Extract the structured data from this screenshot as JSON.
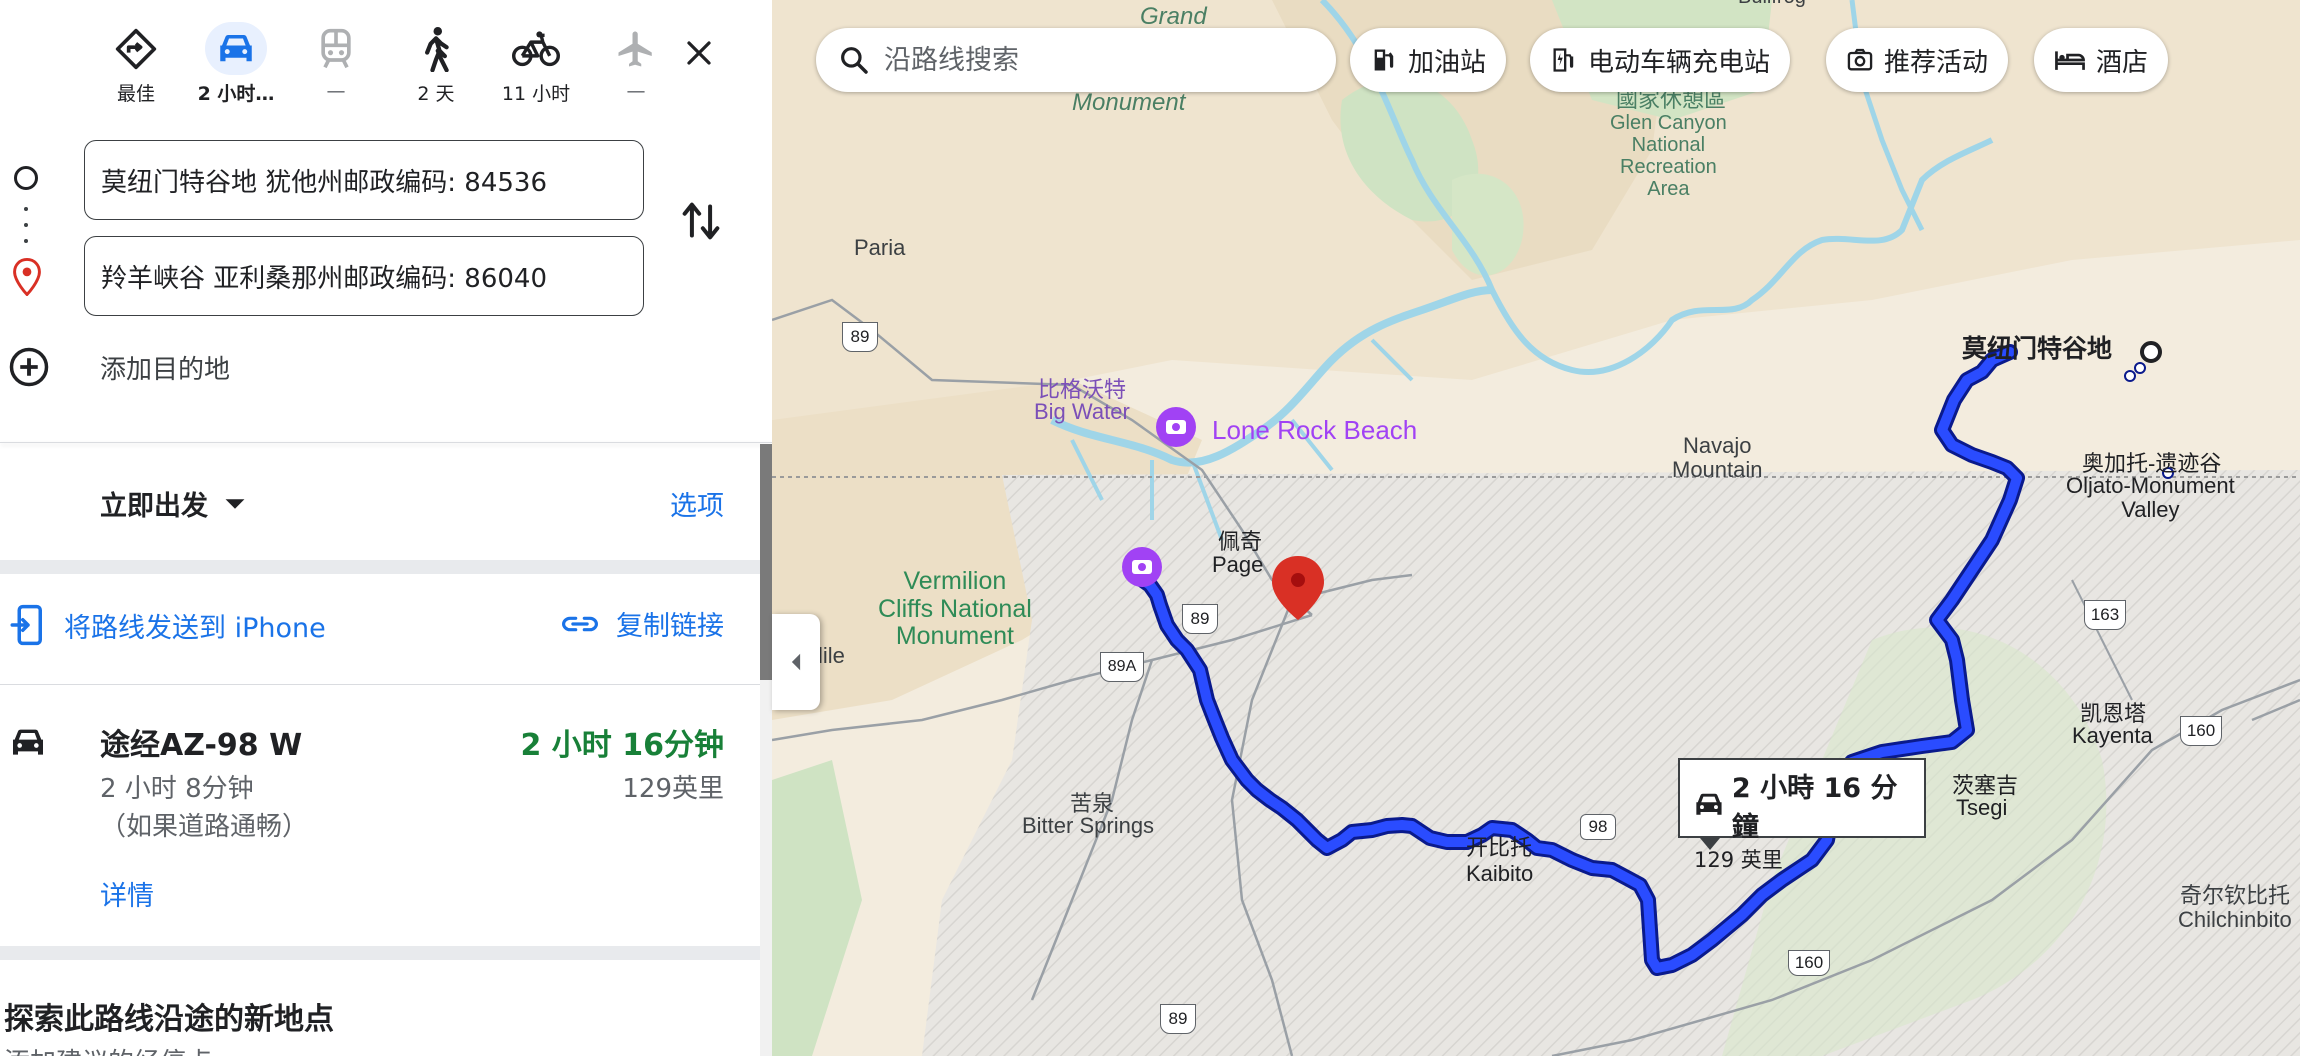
{
  "modes": [
    {
      "name": "best",
      "label": "最佳"
    },
    {
      "name": "drive",
      "label": "2 小时…"
    },
    {
      "name": "transit",
      "label": "—"
    },
    {
      "name": "walk",
      "label": "2 天"
    },
    {
      "name": "bike",
      "label": "11 小时"
    },
    {
      "name": "flight",
      "label": "—"
    }
  ],
  "origin": {
    "value": "莫纽门特谷地 犹他州邮政编码: 84536"
  },
  "destination": {
    "value": "羚羊峡谷 亚利桑那州邮政编码: 86040"
  },
  "add_destination": "添加目的地",
  "depart": {
    "label": "立即出发",
    "options": "选项"
  },
  "share": {
    "send": "将路线发送到 iPhone",
    "copy": "复制链接"
  },
  "route": {
    "name": "途经AZ-98 W",
    "time": "2 小时 16分钟",
    "sub": "2 小时 8分钟",
    "note": "（如果道路通畅）",
    "distance": "129英里",
    "details": "详情"
  },
  "explore": {
    "title": "探索此路线沿途的新地点",
    "sub": "添加建议的经停点"
  },
  "map": {
    "search_placeholder": "沿路线搜索",
    "chips": [
      "加油站",
      "电动车辆充电站",
      "推荐活动",
      "酒店"
    ],
    "route_label": {
      "time": "2 小時 16 分鐘",
      "distance": "129 英里"
    },
    "labels": {
      "grand": "Grand",
      "monument": "Monument",
      "bullfrog": "Bullfrog",
      "glen_zh": "國家休憩區",
      "glen_en": "Glen Canyon\nNational\nRecreation\nArea",
      "paria": "Paria",
      "big_water_zh": "比格沃特",
      "big_water_en": "Big Water",
      "lone_rock": "Lone Rock Beach",
      "navajo": "Navajo\nMountain",
      "page_zh": "佩奇",
      "page_en": "Page",
      "vermilion": "Vermilion\nCliffs National\nMonument",
      "mile": "lile",
      "bitter_zh": "苦泉",
      "bitter_en": "Bitter Springs",
      "kaibito_zh": "开比托",
      "kaibito_en": "Kaibito",
      "tsegi_zh": "茨塞吉",
      "tsegi_en": "Tsegi",
      "kayenta_zh": "凯恩塔",
      "kayenta_en": "Kayenta",
      "oljato_zh": "奥加托-遗迹谷",
      "oljato_en": "Oljato-Monument\nValley",
      "chilchinbito_zh": "奇尔钦比托",
      "chilchinbito_en": "Chilchinbito",
      "monument_valley": "莫纽门特谷地",
      "shields": [
        "89",
        "89",
        "89A",
        "98",
        "163",
        "160",
        "160",
        "89"
      ]
    }
  }
}
